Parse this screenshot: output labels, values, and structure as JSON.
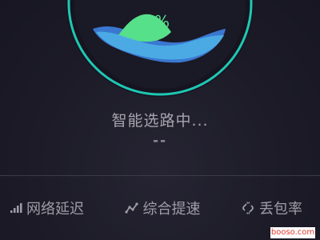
{
  "gauge": {
    "percent_symbol": "%",
    "colors": {
      "ring": "#1fc7b4",
      "wave_back": "#3a78d0",
      "wave_mid": "#4fb3e8",
      "wave_front": "#56e08a",
      "percent": "#56e08a"
    }
  },
  "status": {
    "text": "智能选路中...",
    "value": "--"
  },
  "tabs": [
    {
      "label": "网络延迟",
      "icon": "signal-bars-icon"
    },
    {
      "label": "综合提速",
      "icon": "trend-line-icon"
    },
    {
      "label": "丢包率",
      "icon": "broken-link-icon"
    }
  ],
  "watermark": "booso.com"
}
